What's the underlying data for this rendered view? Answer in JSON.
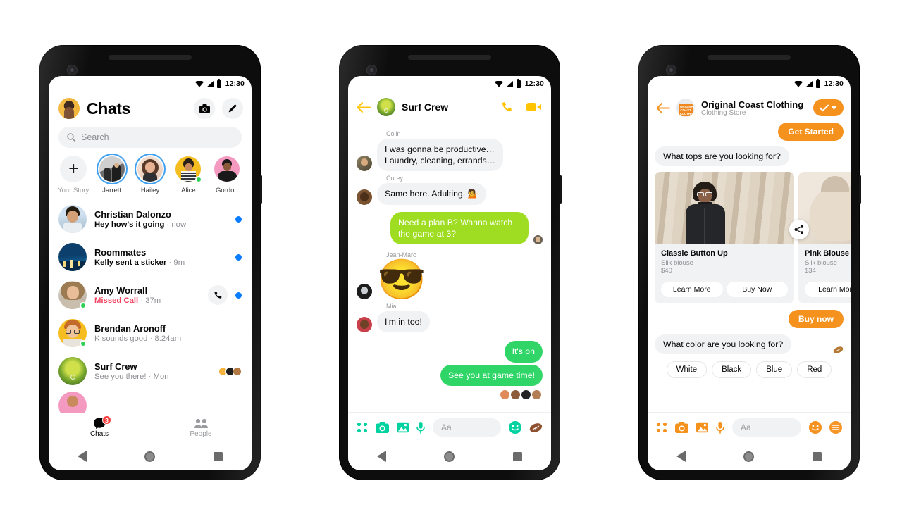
{
  "status_bar": {
    "time": "12:30",
    "icons": [
      "wifi-icon",
      "signal-icon",
      "battery-icon"
    ]
  },
  "colors": {
    "messenger_blue": "#0a7cff",
    "green_lime": "#9fdd22",
    "green_spring": "#2fd566",
    "teal_accent": "#00d2a0",
    "orange_brand": "#f5921e",
    "missed_red": "#f3425f",
    "badge_red": "#fa3e3e",
    "bubble_grey": "#f1f2f3"
  },
  "phone1": {
    "header": {
      "title": "Chats",
      "avatar": "user-avatar",
      "camera_button": "camera-icon",
      "compose_button": "compose-pencil-icon"
    },
    "search": {
      "placeholder": "Search",
      "icon": "search-icon"
    },
    "stories": [
      {
        "label": "Your Story",
        "type": "add",
        "icon": "plus-icon",
        "ring": false,
        "online": false
      },
      {
        "label": "Jarrett",
        "type": "story",
        "ring": true,
        "online": false
      },
      {
        "label": "Hailey",
        "type": "story",
        "ring": true,
        "online": false
      },
      {
        "label": "Alice",
        "type": "story",
        "ring": false,
        "online": true
      },
      {
        "label": "Gordon",
        "type": "story",
        "ring": false,
        "online": false
      }
    ],
    "chats": [
      {
        "name": "Christian Dalonzo",
        "preview": "Hey how's it going",
        "time": "now",
        "unread": true,
        "missed": false,
        "online": false,
        "call_button": false,
        "seen_by": []
      },
      {
        "name": "Roommates",
        "preview": "Kelly sent a sticker",
        "time": "9m",
        "unread": true,
        "missed": false,
        "online": false,
        "call_button": false,
        "seen_by": []
      },
      {
        "name": "Amy Worrall",
        "preview": "Missed Call",
        "time": "37m",
        "unread": true,
        "missed": true,
        "online": true,
        "call_button": true,
        "seen_by": []
      },
      {
        "name": "Brendan Aronoff",
        "preview": "K sounds good",
        "time": "8:24am",
        "unread": false,
        "missed": false,
        "online": true,
        "call_button": false,
        "seen_by": []
      },
      {
        "name": "Surf Crew",
        "preview": "See you there!",
        "time": "Mon",
        "unread": false,
        "missed": false,
        "online": false,
        "call_button": false,
        "seen_by": [
          "a",
          "b",
          "c"
        ]
      }
    ],
    "tabs": [
      {
        "label": "Chats",
        "icon": "chat-bubble-icon",
        "active": true,
        "badge": "3"
      },
      {
        "label": "People",
        "icon": "people-icon",
        "active": false,
        "badge": ""
      }
    ]
  },
  "phone2": {
    "header": {
      "back": "back-arrow-icon",
      "title": "Surf Crew",
      "avatar": "group-avatar",
      "call_button": "phone-icon",
      "video_button": "video-camera-icon"
    },
    "messages": [
      {
        "sender": "Colin",
        "text": "I was gonna be productive…\nLaundry, cleaning, errands…",
        "side": "in",
        "type": "text"
      },
      {
        "sender": "Corey",
        "text": "Same here. Adulting. 💁",
        "side": "in",
        "type": "text"
      },
      {
        "sender": "",
        "text": "Need a plan B? Wanna watch the game at 3?",
        "side": "out",
        "type": "text",
        "bubble_color": "#9fdd22"
      },
      {
        "sender": "Jean-Marc",
        "text": "😎",
        "side": "in",
        "type": "emoji"
      },
      {
        "sender": "Mia",
        "text": "I'm in too!",
        "side": "in",
        "type": "text"
      },
      {
        "sender": "",
        "text": "It's on",
        "side": "out",
        "type": "text",
        "bubble_color": "#2fd566"
      },
      {
        "sender": "",
        "text": "See you at game time!",
        "side": "out",
        "type": "text",
        "bubble_color": "#2fd566"
      }
    ],
    "read_receipts": 4,
    "composer": {
      "placeholder": "Aa",
      "left_icons": [
        "apps-grid-icon",
        "camera-icon",
        "gallery-icon",
        "microphone-icon"
      ],
      "emoji_icon": "smiley-icon",
      "sticker_icon": "football-sticker-icon"
    }
  },
  "phone3": {
    "header": {
      "back": "back-arrow-icon",
      "name": "Original Coast Clothing",
      "category": "Clothing Store",
      "logo_text": "ORIGINAL COAST CLOTHING",
      "verified_pill": [
        "check-icon",
        "chevron-down-icon"
      ]
    },
    "get_started_label": "Get Started",
    "question_tops": "What tops are you looking for?",
    "share_button": "share-icon",
    "products": [
      {
        "title": "Classic Button Up",
        "subtitle": "Silk blouse",
        "price": "$40",
        "buttons": [
          "Learn More",
          "Buy Now"
        ]
      },
      {
        "title": "Pink Blouse",
        "subtitle": "Silk blouse",
        "price": "$34",
        "buttons": [
          "Learn More"
        ]
      }
    ],
    "buy_now_label": "Buy now",
    "question_color": "What color are you looking for?",
    "quick_replies": [
      "White",
      "Black",
      "Blue",
      "Red"
    ],
    "composer": {
      "placeholder": "Aa",
      "left_icons": [
        "apps-grid-icon",
        "camera-icon",
        "gallery-icon",
        "microphone-icon"
      ],
      "emoji_icon": "smiley-icon",
      "menu_icon": "hamburger-menu-icon"
    }
  },
  "android_nav": {
    "back": "nav-back-triangle",
    "home": "nav-home-circle",
    "recents": "nav-recents-square"
  }
}
